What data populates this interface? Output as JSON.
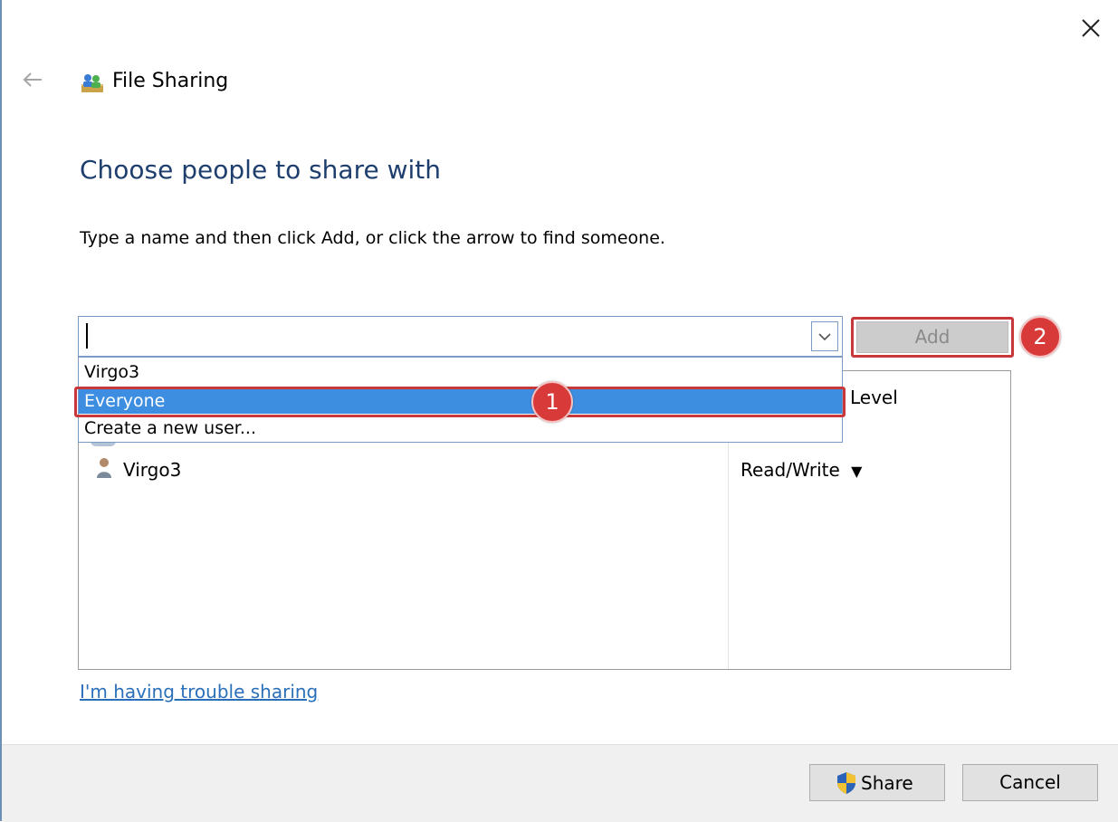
{
  "window": {
    "title": "File Sharing",
    "back_icon": "back-arrow-icon",
    "close_icon": "close-icon",
    "app_icon": "file-sharing-icon"
  },
  "main": {
    "heading": "Choose people to share with",
    "instructions": "Type a name and then click Add, or click the arrow to find someone.",
    "name_input": {
      "value": "",
      "placeholder": ""
    },
    "add_label": "Add",
    "dropdown_items": [
      {
        "label": "Virgo3",
        "selected": false
      },
      {
        "label": "Everyone",
        "selected": true
      },
      {
        "label": "Create a new user...",
        "selected": false
      }
    ],
    "permission_header": "Level",
    "users": [
      {
        "name": "Virgo3",
        "permission": "Read/Write",
        "permission_caret": "▼"
      }
    ],
    "help_link": "I'm having trouble sharing"
  },
  "annotations": {
    "step1": "1",
    "step2": "2"
  },
  "footer": {
    "share_label": "Share",
    "cancel_label": "Cancel"
  },
  "colors": {
    "heading": "#1e3f6e",
    "selection": "#3d8ee0",
    "annotation": "#c8383a",
    "link": "#2a6fba"
  }
}
